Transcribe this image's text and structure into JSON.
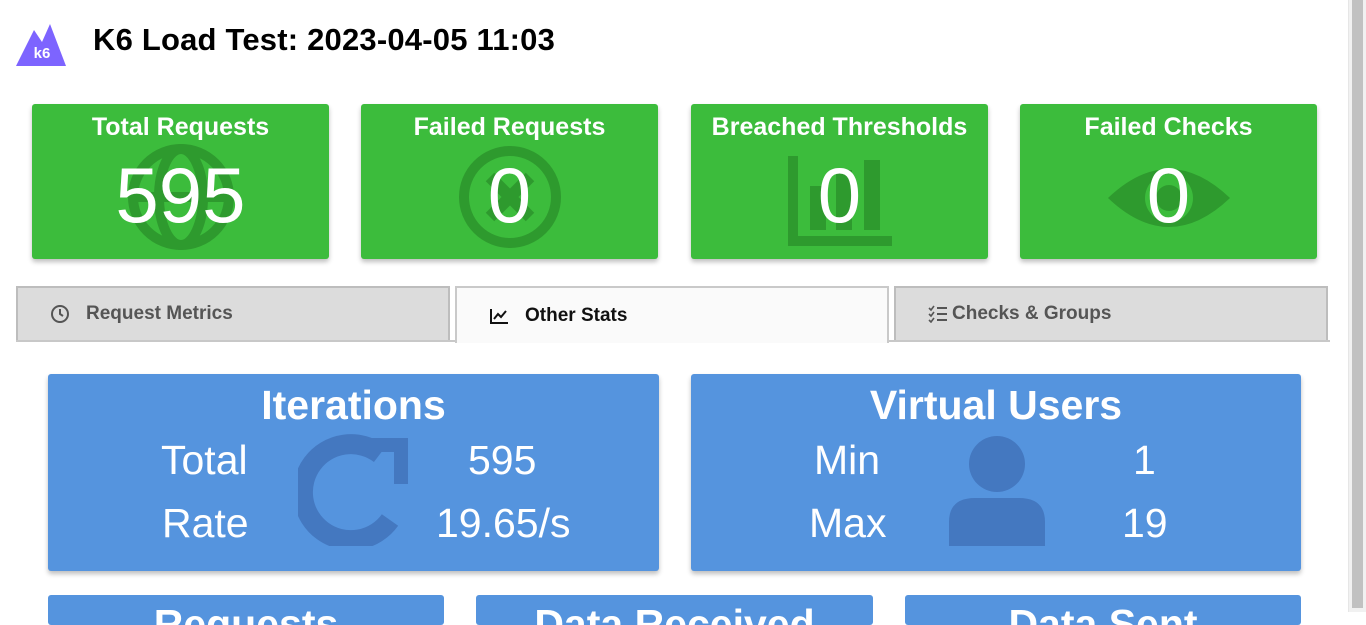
{
  "header": {
    "title": "K6 Load Test: 2023-04-05 11:03",
    "logo_text": "k6"
  },
  "summary_cards": [
    {
      "label": "Total Requests",
      "value": "595",
      "icon": "globe-icon"
    },
    {
      "label": "Failed Requests",
      "value": "0",
      "icon": "x-circle-icon"
    },
    {
      "label": "Breached Thresholds",
      "value": "0",
      "icon": "bar-chart-icon"
    },
    {
      "label": "Failed Checks",
      "value": "0",
      "icon": "eye-icon"
    }
  ],
  "tabs": [
    {
      "label": "Request Metrics",
      "icon": "clock-icon",
      "active": false
    },
    {
      "label": "Other Stats",
      "icon": "line-chart-icon",
      "active": true
    },
    {
      "label": "Checks & Groups",
      "icon": "checklist-icon",
      "active": false
    }
  ],
  "iterations": {
    "title": "Iterations",
    "total_label": "Total",
    "total_value": "595",
    "rate_label": "Rate",
    "rate_value": "19.65/s",
    "icon": "refresh-icon"
  },
  "virtual_users": {
    "title": "Virtual Users",
    "min_label": "Min",
    "min_value": "1",
    "max_label": "Max",
    "max_value": "19",
    "icon": "user-icon"
  },
  "bottom_cards": [
    {
      "title": "Requests"
    },
    {
      "title": "Data Received"
    },
    {
      "title": "Data Sent"
    }
  ],
  "colors": {
    "success": "#3cbc3c",
    "info": "#5594de",
    "logo": "#7d64ff"
  }
}
